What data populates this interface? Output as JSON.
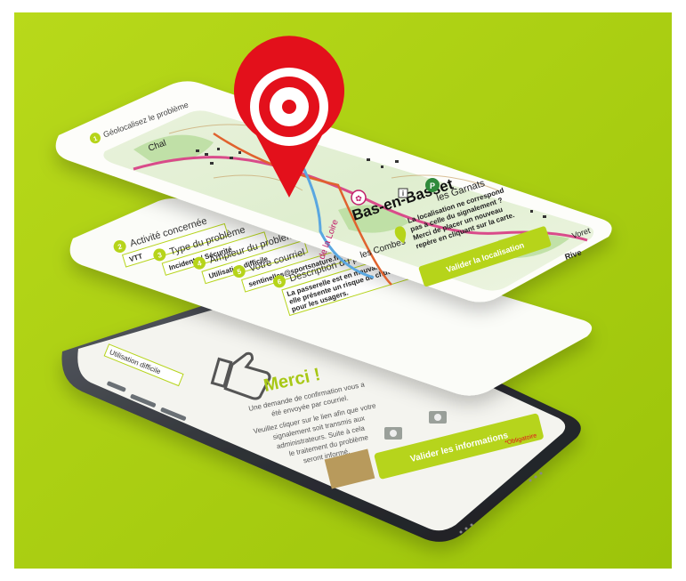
{
  "colors": {
    "background": "#a9cf0d",
    "accent": "#b6d41a",
    "pin_red": "#e3101b",
    "phone_frame": "#3a3d42",
    "card": "#ffffff"
  },
  "map_screen": {
    "step1_label": "Géolocalisez le problème",
    "map_place_names": [
      "Bas-en-Basset",
      "les Garnats",
      "les Combes",
      "Rive",
      "Voret",
      "Chal"
    ],
    "road_label": "de la Loire",
    "notice_text": [
      "La localisation ne correspond",
      "pas à celle du signalement ?",
      "Merci de placer un nouveau",
      "repère en cliquant sur la carte."
    ],
    "validate_location_button": "Valider la localisation",
    "icons": [
      "target-pin-icon",
      "hiker-icon",
      "parking-icon",
      "info-icon",
      "location-icon"
    ]
  },
  "form_screen": {
    "fields": [
      {
        "num": "2",
        "label": "Activité concernée",
        "value": "VTT"
      },
      {
        "num": "3",
        "label": "Type du problème",
        "value": "Incidents / Sécurité"
      },
      {
        "num": "4",
        "label": "Ampleur du problème",
        "value": "Utilisation difficile"
      },
      {
        "num": "5",
        "label": "Votre courriel",
        "value": "sentinelles@sportsnature.fr"
      },
      {
        "num": "6",
        "label": "Description du problème",
        "value": "La passerelle est en mauvais état, elle présente un risque de chute pour les usagers."
      }
    ]
  },
  "phone_screen": {
    "top_tag": "Utilisation difficile",
    "thanks_title": "Merci !",
    "thanks_text": [
      "Une demande de confirmation vous a",
      "été envoyée par courriel.",
      "Veuillez cliquer sur le lien afin que votre",
      "signalement soit transmis aux",
      "administrateurs. Suite à cela",
      "le traitement du problème",
      "seront informé."
    ],
    "validate_info_button": "Valider les informations",
    "required_note": "*Obligatoire",
    "icons": [
      "thumbs-up-icon",
      "camera-icon"
    ]
  }
}
